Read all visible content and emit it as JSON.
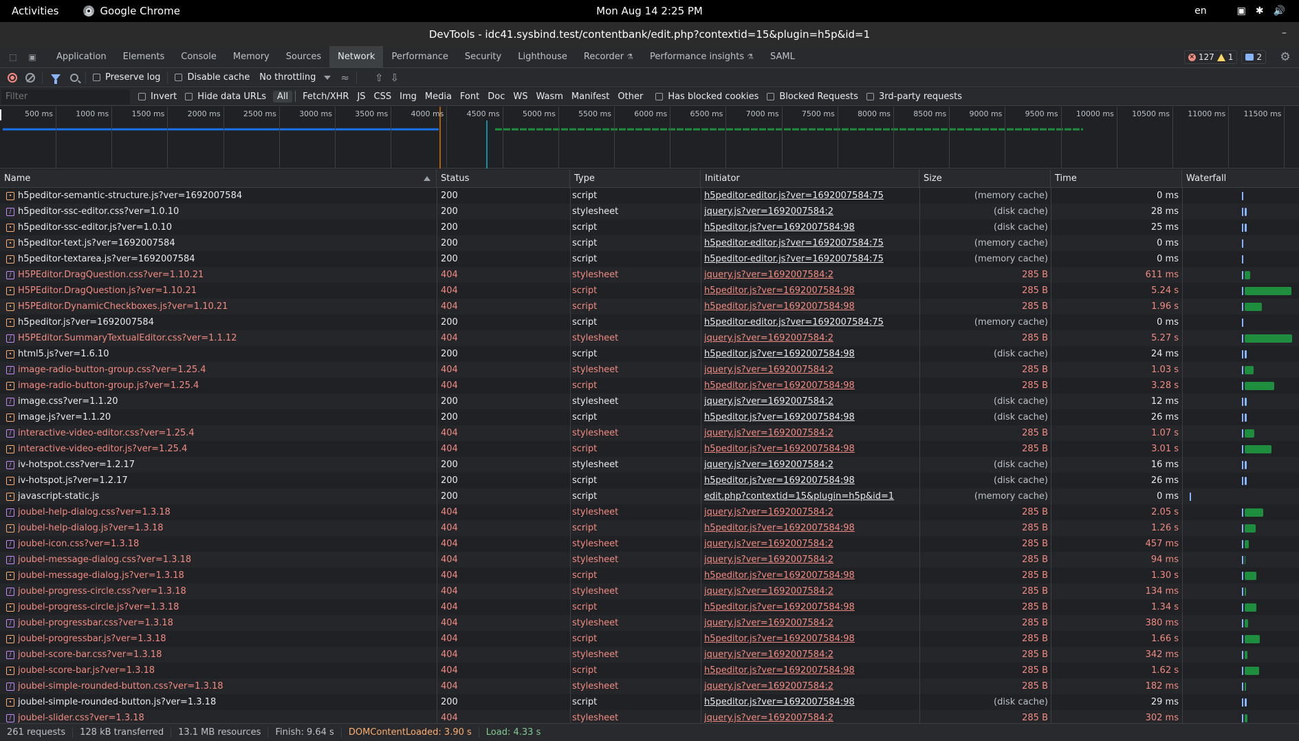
{
  "topbar": {
    "activities": "Activities",
    "app_name": "Google Chrome",
    "clock": "Mon Aug 14   2:25 PM",
    "lang": "en"
  },
  "window": {
    "title": "DevTools - idc41.sysbind.test/contentbank/edit.php?contextid=15&plugin=h5p&id=1"
  },
  "devtools_tabs": [
    {
      "label": "Application"
    },
    {
      "label": "Elements"
    },
    {
      "label": "Console"
    },
    {
      "label": "Memory"
    },
    {
      "label": "Sources"
    },
    {
      "label": "Network"
    },
    {
      "label": "Performance"
    },
    {
      "label": "Security"
    },
    {
      "label": "Lighthouse"
    },
    {
      "label": "Recorder"
    },
    {
      "label": "Performance insights"
    },
    {
      "label": "SAML"
    }
  ],
  "active_tab": "Network",
  "issues": {
    "errors": "127",
    "warnings": "1",
    "messages": "2"
  },
  "toolbar": {
    "preserve_log": "Preserve log",
    "disable_cache": "Disable cache",
    "throttling": "No throttling"
  },
  "filterbar": {
    "placeholder": "Filter",
    "invert": "Invert",
    "hide_data_urls": "Hide data URLs",
    "types": [
      "All",
      "Fetch/XHR",
      "JS",
      "CSS",
      "Img",
      "Media",
      "Font",
      "Doc",
      "WS",
      "Wasm",
      "Manifest",
      "Other"
    ],
    "active_type": "All",
    "has_blocked_cookies": "Has blocked cookies",
    "blocked_requests": "Blocked Requests",
    "third_party": "3rd-party requests"
  },
  "overview": {
    "ticks": [
      "500 ms",
      "1000 ms",
      "1500 ms",
      "2000 ms",
      "2500 ms",
      "3000 ms",
      "3500 ms",
      "4000 ms",
      "4500 ms",
      "5000 ms",
      "5500 ms",
      "6000 ms",
      "6500 ms",
      "7000 ms",
      "7500 ms",
      "8000 ms",
      "8500 ms",
      "9000 ms",
      "9500 ms",
      "10000 ms",
      "10500 ms",
      "11000 ms",
      "11500 ms"
    ]
  },
  "columns": {
    "name": "Name",
    "status": "Status",
    "type": "Type",
    "initiator": "Initiator",
    "size": "Size",
    "time": "Time",
    "waterfall": "Waterfall"
  },
  "requests": [
    {
      "name": "h5peditor-semantic-structure.js?ver=1692007584",
      "status": "200",
      "type": "script",
      "initiator": "h5peditor-editor.js?ver=1692007584:75",
      "size": "(memory cache)",
      "time": "0 ms"
    },
    {
      "name": "h5peditor-ssc-editor.css?ver=1.0.10",
      "status": "200",
      "type": "stylesheet",
      "initiator": "jquery.js?ver=1692007584:2",
      "size": "(disk cache)",
      "time": "28 ms"
    },
    {
      "name": "h5peditor-ssc-editor.js?ver=1.0.10",
      "status": "200",
      "type": "script",
      "initiator": "h5peditor.js?ver=1692007584:98",
      "size": "(disk cache)",
      "time": "25 ms"
    },
    {
      "name": "h5peditor-text.js?ver=1692007584",
      "status": "200",
      "type": "script",
      "initiator": "h5peditor-editor.js?ver=1692007584:75",
      "size": "(memory cache)",
      "time": "0 ms"
    },
    {
      "name": "h5peditor-textarea.js?ver=1692007584",
      "status": "200",
      "type": "script",
      "initiator": "h5peditor-editor.js?ver=1692007584:75",
      "size": "(memory cache)",
      "time": "0 ms"
    },
    {
      "name": "H5PEditor.DragQuestion.css?ver=1.10.21",
      "status": "404",
      "type": "stylesheet",
      "initiator": "jquery.js?ver=1692007584:2",
      "size": "285 B",
      "time": "611 ms"
    },
    {
      "name": "H5PEditor.DragQuestion.js?ver=1.10.21",
      "status": "404",
      "type": "script",
      "initiator": "h5peditor.js?ver=1692007584:98",
      "size": "285 B",
      "time": "5.24 s"
    },
    {
      "name": "H5PEditor.DynamicCheckboxes.js?ver=1.10.21",
      "status": "404",
      "type": "script",
      "initiator": "h5peditor.js?ver=1692007584:98",
      "size": "285 B",
      "time": "1.96 s"
    },
    {
      "name": "h5peditor.js?ver=1692007584",
      "status": "200",
      "type": "script",
      "initiator": "h5peditor-editor.js?ver=1692007584:75",
      "size": "(memory cache)",
      "time": "0 ms"
    },
    {
      "name": "H5PEditor.SummaryTextualEditor.css?ver=1.1.12",
      "status": "404",
      "type": "stylesheet",
      "initiator": "jquery.js?ver=1692007584:2",
      "size": "285 B",
      "time": "5.27 s"
    },
    {
      "name": "html5.js?ver=1.6.10",
      "status": "200",
      "type": "script",
      "initiator": "h5peditor.js?ver=1692007584:98",
      "size": "(disk cache)",
      "time": "24 ms"
    },
    {
      "name": "image-radio-button-group.css?ver=1.25.4",
      "status": "404",
      "type": "stylesheet",
      "initiator": "jquery.js?ver=1692007584:2",
      "size": "285 B",
      "time": "1.03 s"
    },
    {
      "name": "image-radio-button-group.js?ver=1.25.4",
      "status": "404",
      "type": "script",
      "initiator": "h5peditor.js?ver=1692007584:98",
      "size": "285 B",
      "time": "3.28 s"
    },
    {
      "name": "image.css?ver=1.1.20",
      "status": "200",
      "type": "stylesheet",
      "initiator": "jquery.js?ver=1692007584:2",
      "size": "(disk cache)",
      "time": "12 ms"
    },
    {
      "name": "image.js?ver=1.1.20",
      "status": "200",
      "type": "script",
      "initiator": "h5peditor.js?ver=1692007584:98",
      "size": "(disk cache)",
      "time": "26 ms"
    },
    {
      "name": "interactive-video-editor.css?ver=1.25.4",
      "status": "404",
      "type": "stylesheet",
      "initiator": "jquery.js?ver=1692007584:2",
      "size": "285 B",
      "time": "1.07 s"
    },
    {
      "name": "interactive-video-editor.js?ver=1.25.4",
      "status": "404",
      "type": "script",
      "initiator": "h5peditor.js?ver=1692007584:98",
      "size": "285 B",
      "time": "3.01 s"
    },
    {
      "name": "iv-hotspot.css?ver=1.2.17",
      "status": "200",
      "type": "stylesheet",
      "initiator": "jquery.js?ver=1692007584:2",
      "size": "(disk cache)",
      "time": "16 ms"
    },
    {
      "name": "iv-hotspot.js?ver=1.2.17",
      "status": "200",
      "type": "script",
      "initiator": "h5peditor.js?ver=1692007584:98",
      "size": "(disk cache)",
      "time": "26 ms"
    },
    {
      "name": "javascript-static.js",
      "status": "200",
      "type": "script",
      "initiator": "edit.php?contextid=15&plugin=h5p&id=1",
      "size": "(memory cache)",
      "time": "0 ms"
    },
    {
      "name": "joubel-help-dialog.css?ver=1.3.18",
      "status": "404",
      "type": "stylesheet",
      "initiator": "jquery.js?ver=1692007584:2",
      "size": "285 B",
      "time": "2.05 s"
    },
    {
      "name": "joubel-help-dialog.js?ver=1.3.18",
      "status": "404",
      "type": "script",
      "initiator": "h5peditor.js?ver=1692007584:98",
      "size": "285 B",
      "time": "1.26 s"
    },
    {
      "name": "joubel-icon.css?ver=1.3.18",
      "status": "404",
      "type": "stylesheet",
      "initiator": "jquery.js?ver=1692007584:2",
      "size": "285 B",
      "time": "457 ms"
    },
    {
      "name": "joubel-message-dialog.css?ver=1.3.18",
      "status": "404",
      "type": "stylesheet",
      "initiator": "jquery.js?ver=1692007584:2",
      "size": "285 B",
      "time": "94 ms"
    },
    {
      "name": "joubel-message-dialog.js?ver=1.3.18",
      "status": "404",
      "type": "script",
      "initiator": "h5peditor.js?ver=1692007584:98",
      "size": "285 B",
      "time": "1.30 s"
    },
    {
      "name": "joubel-progress-circle.css?ver=1.3.18",
      "status": "404",
      "type": "stylesheet",
      "initiator": "jquery.js?ver=1692007584:2",
      "size": "285 B",
      "time": "134 ms"
    },
    {
      "name": "joubel-progress-circle.js?ver=1.3.18",
      "status": "404",
      "type": "script",
      "initiator": "h5peditor.js?ver=1692007584:98",
      "size": "285 B",
      "time": "1.34 s"
    },
    {
      "name": "joubel-progressbar.css?ver=1.3.18",
      "status": "404",
      "type": "stylesheet",
      "initiator": "jquery.js?ver=1692007584:2",
      "size": "285 B",
      "time": "380 ms"
    },
    {
      "name": "joubel-progressbar.js?ver=1.3.18",
      "status": "404",
      "type": "script",
      "initiator": "h5peditor.js?ver=1692007584:98",
      "size": "285 B",
      "time": "1.66 s"
    },
    {
      "name": "joubel-score-bar.css?ver=1.3.18",
      "status": "404",
      "type": "stylesheet",
      "initiator": "jquery.js?ver=1692007584:2",
      "size": "285 B",
      "time": "342 ms"
    },
    {
      "name": "joubel-score-bar.js?ver=1.3.18",
      "status": "404",
      "type": "script",
      "initiator": "h5peditor.js?ver=1692007584:98",
      "size": "285 B",
      "time": "1.62 s"
    },
    {
      "name": "joubel-simple-rounded-button.css?ver=1.3.18",
      "status": "404",
      "type": "stylesheet",
      "initiator": "jquery.js?ver=1692007584:2",
      "size": "285 B",
      "time": "182 ms"
    },
    {
      "name": "joubel-simple-rounded-button.js?ver=1.3.18",
      "status": "200",
      "type": "script",
      "initiator": "h5peditor.js?ver=1692007584:98",
      "size": "(disk cache)",
      "time": "29 ms"
    },
    {
      "name": "joubel-slider.css?ver=1.3.18",
      "status": "404",
      "type": "stylesheet",
      "initiator": "jquery.js?ver=1692007584:2",
      "size": "285 B",
      "time": "302 ms"
    }
  ],
  "statusbar": {
    "requests": "261 requests",
    "transferred": "128 kB transferred",
    "resources": "13.1 MB resources",
    "finish": "Finish: 9.64 s",
    "dcl": "DOMContentLoaded: 3.90 s",
    "load": "Load: 4.33 s"
  },
  "colors": {
    "error": "#f28b82",
    "bar": "#1e8e3e",
    "accent": "#8ab4f8"
  }
}
